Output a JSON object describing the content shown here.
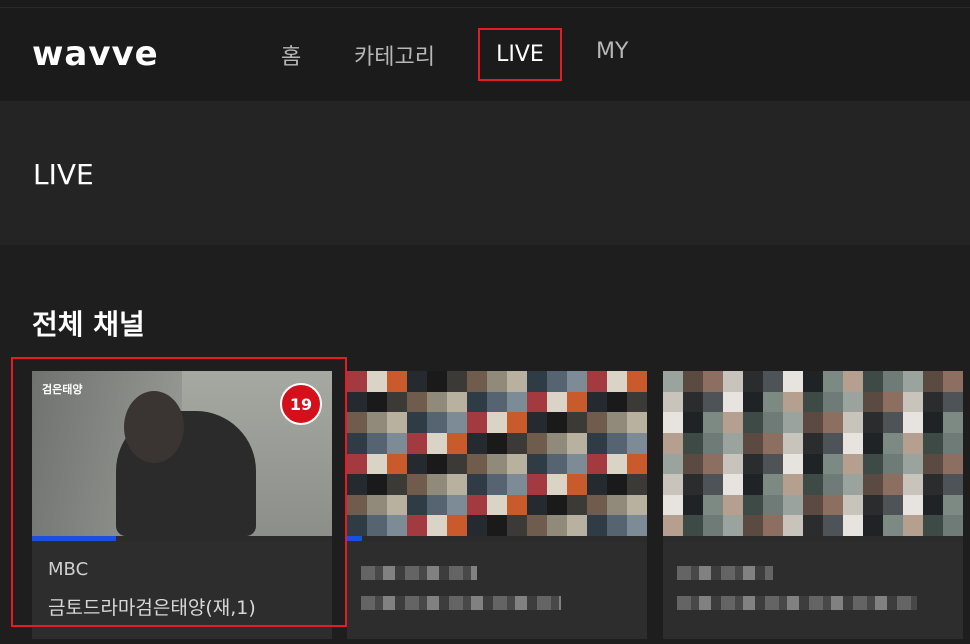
{
  "header": {
    "logo": "wavve",
    "nav": [
      {
        "label": "홈"
      },
      {
        "label": "카테고리"
      },
      {
        "label": "LIVE",
        "active": true
      },
      {
        "label": "MY"
      }
    ]
  },
  "page": {
    "title": "LIVE"
  },
  "section": {
    "title": "전체 채널"
  },
  "cards": [
    {
      "channel": "MBC",
      "program": "금토드라마검은태양(재,1)",
      "rating": "19",
      "thumb_caption": "검은태양",
      "progress": 0.28
    },
    {
      "channel": "",
      "program": "",
      "progress": 0.05
    },
    {
      "channel": "",
      "program": "",
      "progress": 0
    }
  ],
  "colors": {
    "accent_red": "#e41d25",
    "progress_blue": "#1c4fdf",
    "header_bg": "#1b1b1b",
    "banner_bg": "#242424"
  }
}
